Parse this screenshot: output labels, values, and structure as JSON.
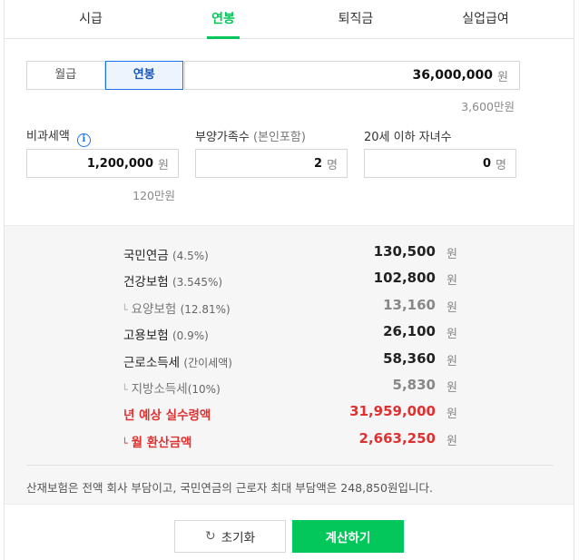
{
  "tabs": [
    {
      "label": "시급",
      "active": false
    },
    {
      "label": "연봉",
      "active": true
    },
    {
      "label": "퇴직금",
      "active": false
    },
    {
      "label": "실업급여",
      "active": false
    }
  ],
  "pay_toggle": {
    "monthly": "월급",
    "annual": "연봉",
    "selected": "연봉"
  },
  "salary": {
    "value": "36,000,000",
    "unit": "원",
    "hint": "3,600만원"
  },
  "nontax": {
    "label": "비과세액",
    "value": "1,200,000",
    "unit": "원",
    "hint": "120만원"
  },
  "dependents": {
    "label": "부양가족수",
    "paren": "(본인포함)",
    "value": "2",
    "unit": "명"
  },
  "children": {
    "label": "20세 이하 자녀수",
    "value": "0",
    "unit": "명"
  },
  "results": {
    "won": "원",
    "pension": {
      "label": "국민연금",
      "pct": "(4.5%)",
      "amount": "130,500"
    },
    "health": {
      "label": "건강보험",
      "pct": "(3.545%)",
      "amount": "102,800"
    },
    "care": {
      "label": "요양보험",
      "pct": "(12.81%)",
      "amount": "13,160"
    },
    "employ": {
      "label": "고용보험",
      "pct": "(0.9%)",
      "amount": "26,100"
    },
    "income_tax": {
      "label": "근로소득세",
      "pct": "(간이세액)",
      "amount": "58,360"
    },
    "local_tax": {
      "label": "지방소득세",
      "pct": "(10%)",
      "amount": "5,830"
    },
    "annual_net": {
      "label": "년 예상 실수령액",
      "amount": "31,959,000"
    },
    "monthly_net": {
      "label": "월 환산금액",
      "amount": "2,663,250"
    }
  },
  "note": "산재보험은 전액 회사 부담이고, 국민연금의 근로자 최대 부담액은 248,850원입니다.",
  "buttons": {
    "reset": "초기화",
    "calculate": "계산하기"
  },
  "colors": {
    "accent": "#03c75a",
    "selected": "#1a73e8",
    "highlight": "#e03131"
  }
}
